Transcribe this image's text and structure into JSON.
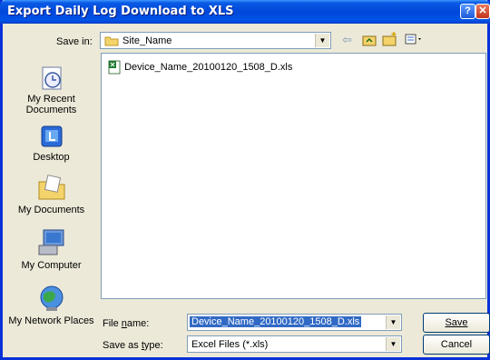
{
  "window": {
    "title": "Export Daily Log Download to XLS"
  },
  "toolbar": {
    "save_in_label": "Save in:",
    "save_in_value": "Site_Name"
  },
  "places": [
    {
      "label": "My Recent Documents"
    },
    {
      "label": "Desktop"
    },
    {
      "label": "My Documents"
    },
    {
      "label": "My Computer"
    },
    {
      "label": "My Network Places"
    }
  ],
  "files": [
    {
      "name": "Device_Name_20100120_1508_D.xls"
    }
  ],
  "form": {
    "file_name_label": "File name:",
    "file_name_value": "Device_Name_20100120_1508_D.xls",
    "save_as_type_label": "Save as type:",
    "save_as_type_value": "Excel Files (*.xls)"
  },
  "buttons": {
    "save": "Save",
    "cancel": "Cancel"
  },
  "colors": {
    "title_bar": "#0a5ae5",
    "selection": "#316ac5",
    "dialog_bg": "#ece9d8"
  }
}
